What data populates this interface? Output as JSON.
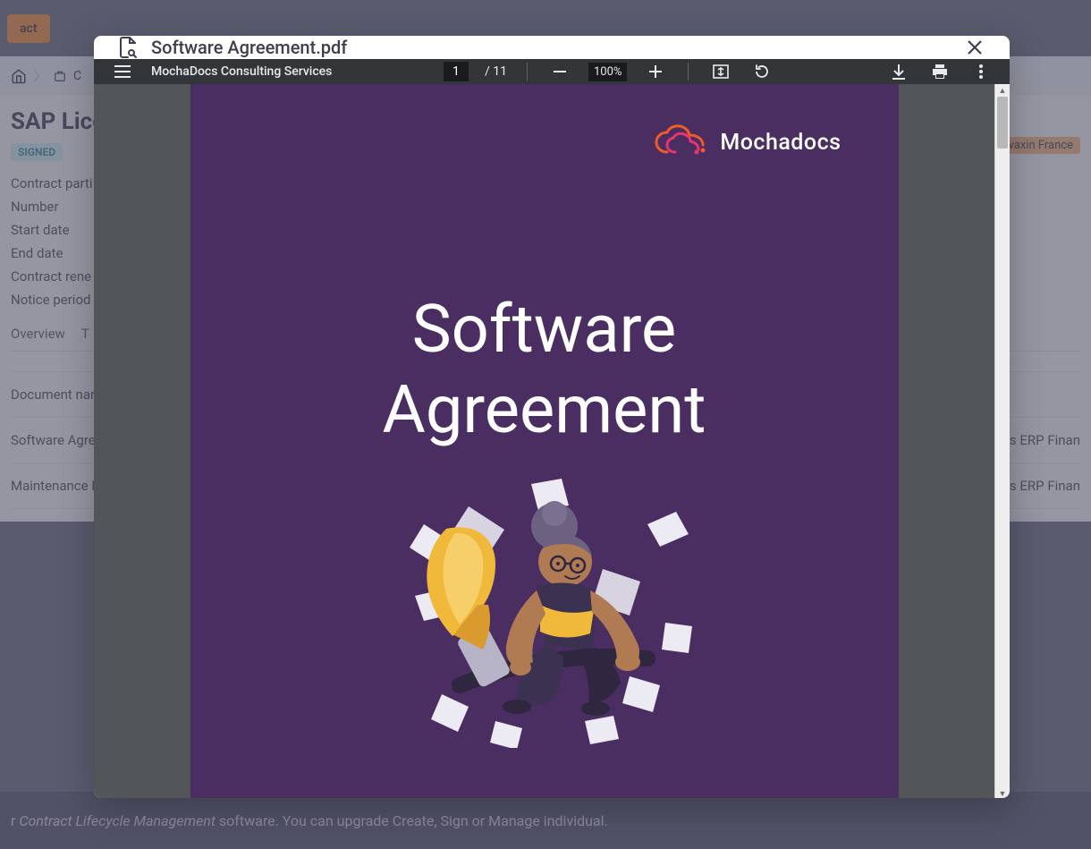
{
  "background": {
    "header_button": "act",
    "breadcrumb_letter": "C",
    "page_title": "SAP Lice",
    "status_badge": "SIGNED",
    "fields": [
      "Contract parti",
      "Number",
      "Start date",
      "End date",
      "Contract rene",
      "Notice period"
    ],
    "tabs": [
      "Overview",
      "T"
    ],
    "section_label": "Document nam",
    "rows": [
      "Software Agre",
      "Maintenance F"
    ],
    "right_tag": "Revaxin France",
    "right_col": "ses ERP Finan",
    "footer_text_a": "r ",
    "footer_em": "Contract Lifecycle Management",
    "footer_text_b": " software. You can upgrade Create, Sign or Manage individual."
  },
  "modal": {
    "filename": "Software Agreement.pdf"
  },
  "pdf_toolbar": {
    "doc_name": "MochaDocs Consulting Services",
    "current_page": "1",
    "total_pages": "11",
    "page_sep": "/",
    "zoom": "100%"
  },
  "pdf_page": {
    "logo_text": "Mochadocs",
    "title": "Software Agreement",
    "title_l1": "Software",
    "title_l2": "Agreement"
  }
}
